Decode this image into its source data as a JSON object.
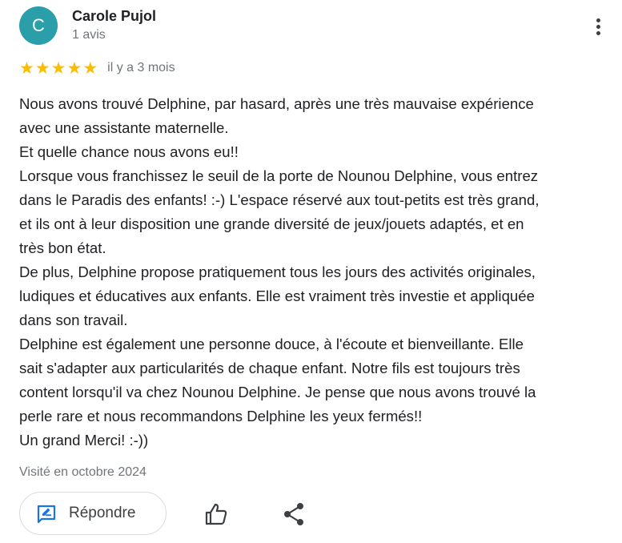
{
  "author": {
    "initial": "C",
    "name": "Carole Pujol",
    "meta": "1 avis",
    "avatar_color": "#2a9ea9"
  },
  "more_icon": "more-vert-icon",
  "rating": {
    "stars": 5,
    "max": 5,
    "star_color": "#fbbc04",
    "date": "il y a 3 mois"
  },
  "review": {
    "text": "Nous avons trouvé Delphine, par hasard, après une très mauvaise expérience\navec une assistante maternelle.\nEt quelle chance nous avons eu!!\nLorsque vous franchissez le seuil de la porte de Nounou Delphine, vous entrez\ndans le Paradis des enfants! :-) L'espace réservé aux tout-petits est très grand,\net ils ont à leur disposition une grande diversité de jeux/jouets adaptés, et en\ntrès bon état.\nDe plus, Delphine propose pratiquement tous les jours des activités originales,\nludiques et éducatives aux enfants. Elle est vraiment très investie et appliquée\ndans son travail.\nDelphine est également une personne douce, à l'écoute et bienveillante. Elle\nsait s'adapter aux particularités de chaque enfant. Notre fils est toujours très\ncontent lorsqu'il va chez Nounou Delphine. Je pense que nous avons trouvé la\nperle rare et nous recommandons Delphine les yeux fermés!!\nUn grand Merci! :-))",
    "visited": "Visité en octobre 2024"
  },
  "actions": {
    "reply_label": "Répondre",
    "reply_icon": "reply-edit-icon",
    "like_icon": "thumb-up-icon",
    "share_icon": "share-icon",
    "accent_color": "#1a73e8"
  }
}
